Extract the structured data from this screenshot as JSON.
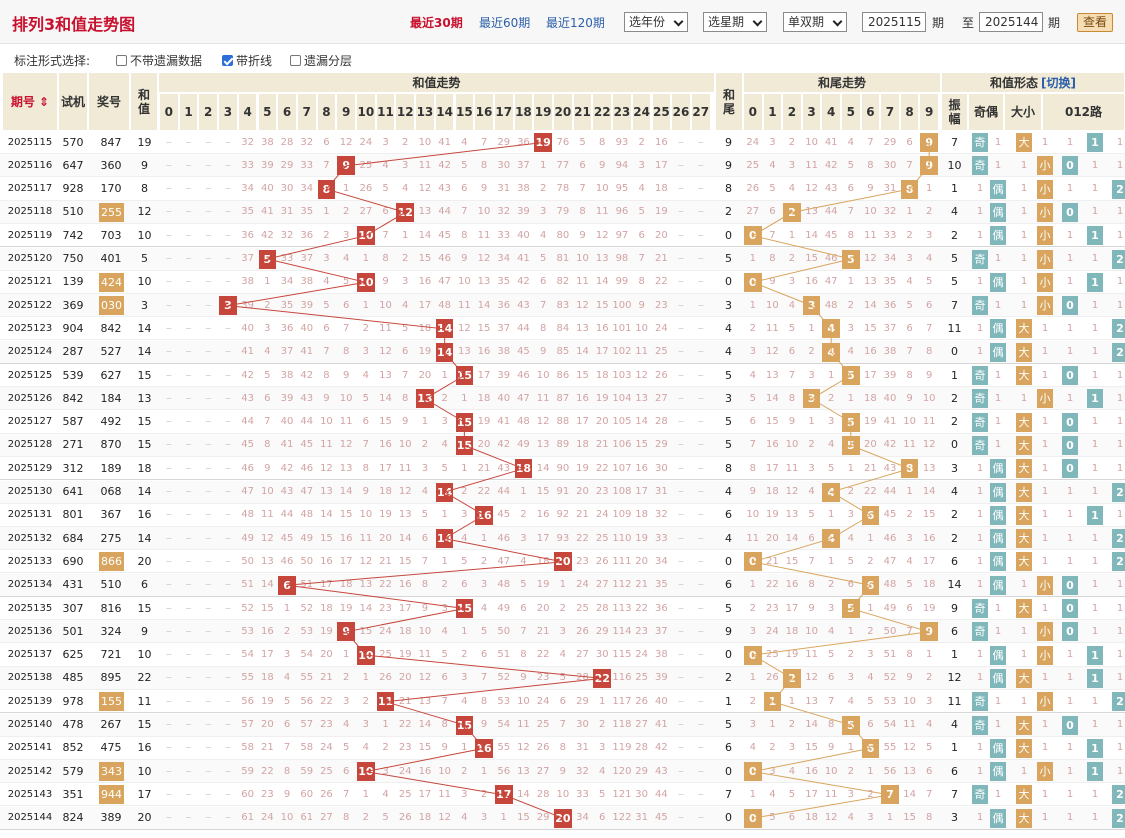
{
  "header": {
    "title": "排列3和值走势图",
    "links": [
      "最近30期",
      "最近60期",
      "最近120期"
    ],
    "selects": [
      "选年份",
      "选星期",
      "单双期"
    ],
    "from_issue": "2025115",
    "to_issue": "2025144",
    "issue_label": "期",
    "to_label": "至",
    "query": "查看"
  },
  "options": {
    "label": "标注形式选择:",
    "items": [
      {
        "label": "不带遗漏数据",
        "checked": false
      },
      {
        "label": "带折线",
        "checked": true
      },
      {
        "label": "遗漏分层",
        "checked": false
      }
    ]
  },
  "columns": {
    "issue": "期号",
    "trial": "试机",
    "prize": "奖号",
    "hz": "和值",
    "sum_trend": "和值走势",
    "tail": "和尾",
    "tail_trend": "和尾走势",
    "shape": "和值形态",
    "switch": "[切换]",
    "amp": "振幅",
    "oe": "奇偶",
    "bs": "大小",
    "route": "012路"
  },
  "labels": {
    "odd": "奇",
    "even": "偶",
    "big": "大",
    "small": "小"
  },
  "colors": {
    "hit": "#c7463b",
    "tail": "#d9a55e",
    "teal": "#7fb7bb",
    "header_bg": "#f0ead6"
  },
  "chart_data": {
    "type": "table",
    "rows": [
      {
        "issue": "2025115",
        "trial": "570",
        "prize": "847",
        "pair": false,
        "sum": 19
      },
      {
        "issue": "2025116",
        "trial": "647",
        "prize": "360",
        "pair": false,
        "sum": 9
      },
      {
        "issue": "2025117",
        "trial": "928",
        "prize": "170",
        "pair": false,
        "sum": 8
      },
      {
        "issue": "2025118",
        "trial": "510",
        "prize": "255",
        "pair": true,
        "sum": 12
      },
      {
        "issue": "2025119",
        "trial": "742",
        "prize": "703",
        "pair": false,
        "sum": 10
      },
      {
        "issue": "2025120",
        "trial": "750",
        "prize": "401",
        "pair": false,
        "sum": 5
      },
      {
        "issue": "2025121",
        "trial": "139",
        "prize": "424",
        "pair": true,
        "sum": 10
      },
      {
        "issue": "2025122",
        "trial": "369",
        "prize": "030",
        "pair": true,
        "sum": 3
      },
      {
        "issue": "2025123",
        "trial": "904",
        "prize": "842",
        "pair": false,
        "sum": 14
      },
      {
        "issue": "2025124",
        "trial": "287",
        "prize": "527",
        "pair": false,
        "sum": 14
      },
      {
        "issue": "2025125",
        "trial": "539",
        "prize": "627",
        "pair": false,
        "sum": 15
      },
      {
        "issue": "2025126",
        "trial": "842",
        "prize": "184",
        "pair": false,
        "sum": 13
      },
      {
        "issue": "2025127",
        "trial": "587",
        "prize": "492",
        "pair": false,
        "sum": 15
      },
      {
        "issue": "2025128",
        "trial": "271",
        "prize": "870",
        "pair": false,
        "sum": 15
      },
      {
        "issue": "2025129",
        "trial": "312",
        "prize": "189",
        "pair": false,
        "sum": 18
      },
      {
        "issue": "2025130",
        "trial": "641",
        "prize": "068",
        "pair": false,
        "sum": 14
      },
      {
        "issue": "2025131",
        "trial": "801",
        "prize": "367",
        "pair": false,
        "sum": 16
      },
      {
        "issue": "2025132",
        "trial": "684",
        "prize": "275",
        "pair": false,
        "sum": 14
      },
      {
        "issue": "2025133",
        "trial": "690",
        "prize": "866",
        "pair": true,
        "sum": 20
      },
      {
        "issue": "2025134",
        "trial": "431",
        "prize": "510",
        "pair": false,
        "sum": 6
      },
      {
        "issue": "2025135",
        "trial": "307",
        "prize": "816",
        "pair": false,
        "sum": 15
      },
      {
        "issue": "2025136",
        "trial": "501",
        "prize": "324",
        "pair": false,
        "sum": 9
      },
      {
        "issue": "2025137",
        "trial": "625",
        "prize": "721",
        "pair": false,
        "sum": 10
      },
      {
        "issue": "2025138",
        "trial": "485",
        "prize": "895",
        "pair": false,
        "sum": 22
      },
      {
        "issue": "2025139",
        "trial": "978",
        "prize": "155",
        "pair": true,
        "sum": 11
      },
      {
        "issue": "2025140",
        "trial": "478",
        "prize": "267",
        "pair": false,
        "sum": 15
      },
      {
        "issue": "2025141",
        "trial": "852",
        "prize": "475",
        "pair": false,
        "sum": 16
      },
      {
        "issue": "2025142",
        "trial": "579",
        "prize": "343",
        "pair": true,
        "sum": 10
      },
      {
        "issue": "2025143",
        "trial": "351",
        "prize": "944",
        "pair": true,
        "sum": 17
      },
      {
        "issue": "2025144",
        "trial": "824",
        "prize": "389",
        "pair": false,
        "sum": 20
      }
    ]
  }
}
